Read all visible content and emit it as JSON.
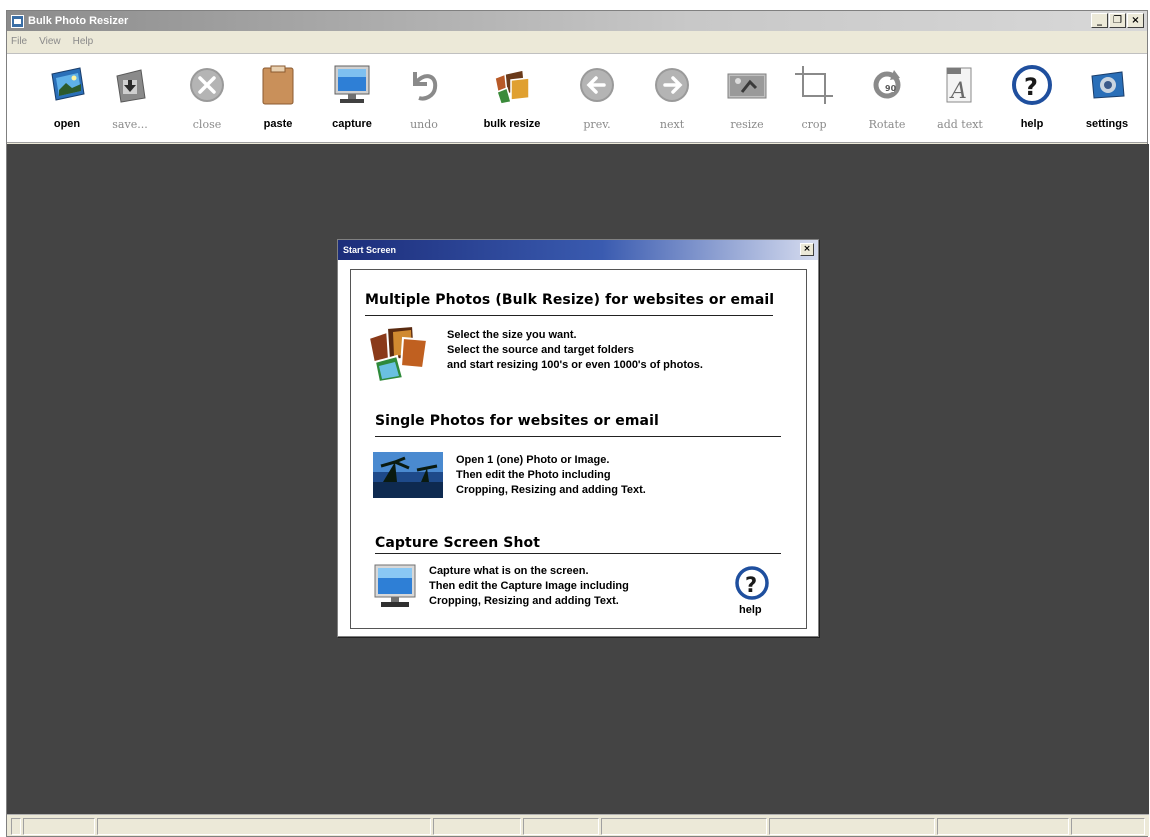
{
  "window": {
    "title": "Bulk Photo Resizer"
  },
  "window_controls": {
    "minimize": "_",
    "restore": "❐",
    "close": "×"
  },
  "menu": [
    "File",
    "View",
    "Help"
  ],
  "toolbar": [
    {
      "label": "open",
      "icon": "open-folder-photo-icon",
      "enabled": true
    },
    {
      "label": "save...",
      "icon": "save-download-icon",
      "enabled": false
    },
    {
      "label": "close",
      "icon": "close-circle-icon",
      "enabled": false
    },
    {
      "label": "paste",
      "icon": "clipboard-icon",
      "enabled": true
    },
    {
      "label": "capture",
      "icon": "monitor-icon",
      "enabled": true
    },
    {
      "label": "undo",
      "icon": "undo-arrow-icon",
      "enabled": false
    },
    {
      "label": "bulk resize",
      "icon": "photo-stack-icon",
      "enabled": true
    },
    {
      "label": "prev.",
      "icon": "arrow-left-circle-icon",
      "enabled": false
    },
    {
      "label": "next",
      "icon": "arrow-right-circle-icon",
      "enabled": false
    },
    {
      "label": "resize",
      "icon": "resize-photo-icon",
      "enabled": false
    },
    {
      "label": "crop",
      "icon": "crop-icon",
      "enabled": false
    },
    {
      "label": "Rotate",
      "icon": "rotate-90-icon",
      "enabled": false
    },
    {
      "label": "add text",
      "icon": "add-text-icon",
      "enabled": false
    },
    {
      "label": "help",
      "icon": "help-question-icon",
      "enabled": true
    },
    {
      "label": "settings",
      "icon": "settings-camera-icon",
      "enabled": true
    }
  ],
  "dialog": {
    "title": "Start Screen",
    "close": "×",
    "sections": [
      {
        "heading": "Multiple Photos (Bulk Resize) for websites or email",
        "icon": "photo-stack-icon",
        "lines": [
          "Select the size you want.",
          "Select the source and target folders",
          "and start resizing 100's or even 1000's of photos."
        ]
      },
      {
        "heading": "Single Photos for websites or email",
        "icon": "landscape-photo-icon",
        "lines": [
          "Open 1 (one) Photo or Image.",
          "Then edit the Photo including",
          "Cropping, Resizing and adding Text."
        ]
      },
      {
        "heading": "Capture Screen Shot",
        "icon": "monitor-icon",
        "lines": [
          "Capture what is on the screen.",
          "Then edit the Capture Image including",
          "Cropping,  Resizing and adding Text."
        ]
      }
    ],
    "help_label": "help"
  },
  "colors": {
    "workspace": "#444444",
    "dialog_title_start": "#1c2d7a",
    "help_blue": "#1f4f9e"
  }
}
